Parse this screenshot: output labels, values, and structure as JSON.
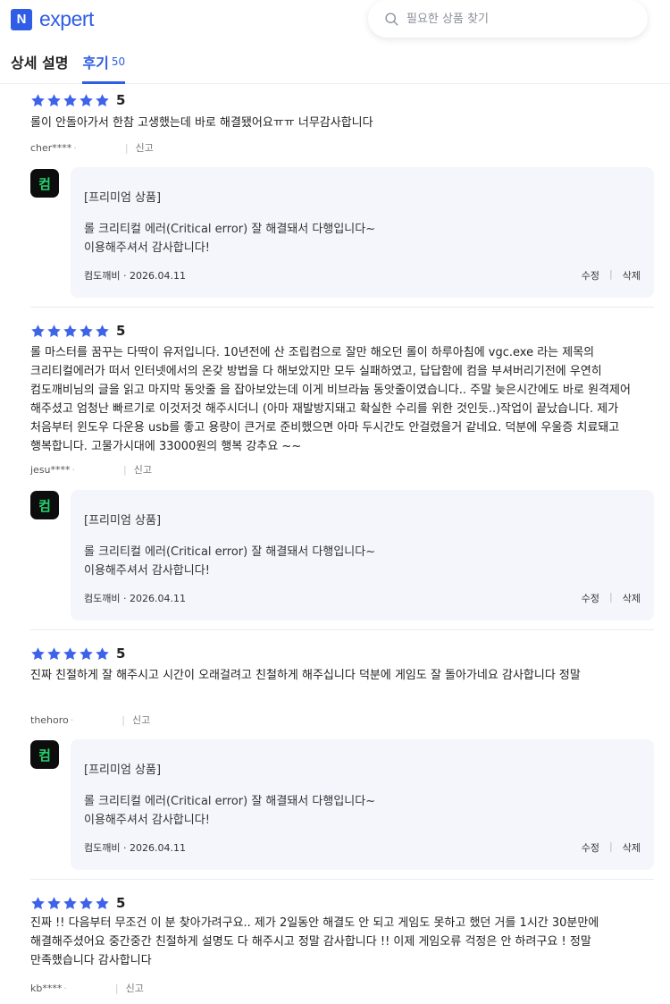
{
  "header": {
    "logo_mark": "N",
    "logo_text": "expert",
    "search_placeholder": "필요한 상품 찾기"
  },
  "tabs": [
    {
      "label": "상세 설명",
      "count": ""
    },
    {
      "label": "후기",
      "count": "50"
    }
  ],
  "reviews": [
    {
      "stars": 5,
      "score": "5",
      "text": "롤이 안돌아가서 한참 고생했는데 바로 해결됐어요ㅠㅠ 너무감사합니다",
      "user": "cher****",
      "report": "신고",
      "reply": {
        "avatar": "컴",
        "title": "[프리미엄 상품]",
        "line1": "롤 크리티컬 에러(Critical error) 잘 해결돼서 다행입니다~",
        "line2": "이용해주셔서 감사합니다!",
        "author": "컴도깨비 · 2026.04.11",
        "edit": "수정",
        "delete": "삭제"
      }
    },
    {
      "stars": 5,
      "score": "5",
      "text": "롤 마스터를 꿈꾸는 다딱이 유저입니다. 10년전에 산 조립컴으로 잘만 해오던 롤이 하루아침에 vgc.exe 라는 제목의 크리티컬에러가 떠서 인터넷에서의 온갖 방법을 다 해보았지만 모두 실패하였고, 답답함에 컴을 부셔버리기전에 우연히 컴도깨비님의 글을 읽고 마지막 동앗줄 을 잡아보았는데 이게 비브라늄 동앗줄이였습니다.. 주말 늦은시간에도 바로 원격제어 해주셨고 엄청난 빠르기로 이것저것 해주시더니 (아마 재발방지돼고 확실한 수리를 위한 것인듯..)작업이 끝났습니다. 제가 처음부터 윈도우 다운용 usb를 좋고 용량이 큰거로 준비했으면 아마 두시간도 안걸렸을거 같네요. 덕분에 우울증 치료돼고 행복합니다. 고물가시대에 33000원의 행복 강추요 ~~",
      "user": "jesu****",
      "report": "신고",
      "reply": {
        "avatar": "컴",
        "title": "[프리미엄 상품]",
        "line1": "롤 크리티컬 에러(Critical error) 잘 해결돼서 다행입니다~",
        "line2": "이용해주셔서 감사합니다!",
        "author": "컴도깨비 · 2026.04.11",
        "edit": "수정",
        "delete": "삭제"
      }
    },
    {
      "stars": 5,
      "score": "5",
      "text": "진짜 친절하게 잘 해주시고 시간이 오래걸려고 친철하게 해주십니다 덕분에 게임도 잘 돌아가네요 감사합니다 정말",
      "user": "thehoro",
      "report": "신고",
      "reply": {
        "avatar": "컴",
        "title": "[프리미엄 상품]",
        "line1": "롤 크리티컬 에러(Critical error) 잘 해결돼서 다행입니다~",
        "line2": "이용해주셔서 감사합니다!",
        "author": "컴도깨비 · 2026.04.11",
        "edit": "수정",
        "delete": "삭제"
      }
    },
    {
      "stars": 5,
      "score": "5",
      "text": "진짜 !! 다음부터 무조건 이 분 찾아가려구요.. 제가 2일동안 해결도 안 되고 게임도 못하고 했던 거를 1시간 30분만에 해결해주셨어요 중간중간 친절하게 설명도 다 해주시고 정말 감사합니다 !! 이제 게임오류 걱정은 안 하려구요 ! 정말 만족했습니다 감사합니다",
      "user": "kb****",
      "report": "신고"
    }
  ]
}
